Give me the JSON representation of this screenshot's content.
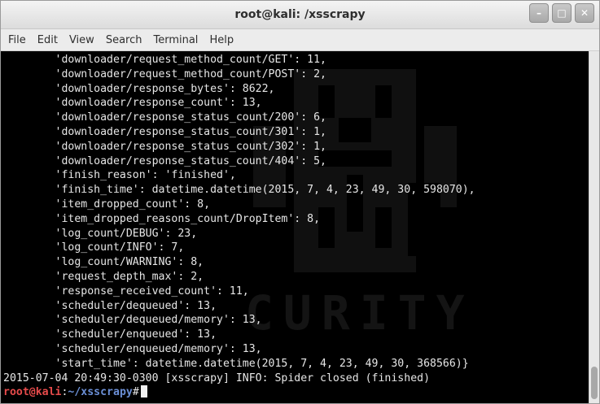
{
  "window": {
    "title": "root@kali: /xsscrapy",
    "buttons": {
      "minimize": "–",
      "maximize": "□",
      "close": "✕"
    }
  },
  "menu": [
    "File",
    "Edit",
    "View",
    "Search",
    "Terminal",
    "Help"
  ],
  "terminal": {
    "lines": [
      "        'downloader/request_method_count/GET': 11,",
      "        'downloader/request_method_count/POST': 2,",
      "        'downloader/response_bytes': 8622,",
      "        'downloader/response_count': 13,",
      "        'downloader/response_status_count/200': 6,",
      "        'downloader/response_status_count/301': 1,",
      "        'downloader/response_status_count/302': 1,",
      "        'downloader/response_status_count/404': 5,",
      "        'finish_reason': 'finished',",
      "        'finish_time': datetime.datetime(2015, 7, 4, 23, 49, 30, 598070),",
      "        'item_dropped_count': 8,",
      "        'item_dropped_reasons_count/DropItem': 8,",
      "        'log_count/DEBUG': 23,",
      "        'log_count/INFO': 7,",
      "        'log_count/WARNING': 8,",
      "        'request_depth_max': 2,",
      "        'response_received_count': 11,",
      "        'scheduler/dequeued': 13,",
      "        'scheduler/dequeued/memory': 13,",
      "        'scheduler/enqueued': 13,",
      "        'scheduler/enqueued/memory': 13,",
      "        'start_time': datetime.datetime(2015, 7, 4, 23, 49, 30, 368566)}",
      "2015-07-04 20:49:30-0300 [xsscrapy] INFO: Spider closed (finished)"
    ],
    "prompt": {
      "user": "root@kali",
      "sep": ":",
      "path": "~/xsscrapy",
      "symbol": "#"
    },
    "watermark": "CURITY"
  },
  "colors": {
    "background": "#000000",
    "text": "#e6e6e6",
    "prompt_user": "#e74b4b",
    "prompt_path": "#6b8fd6"
  }
}
